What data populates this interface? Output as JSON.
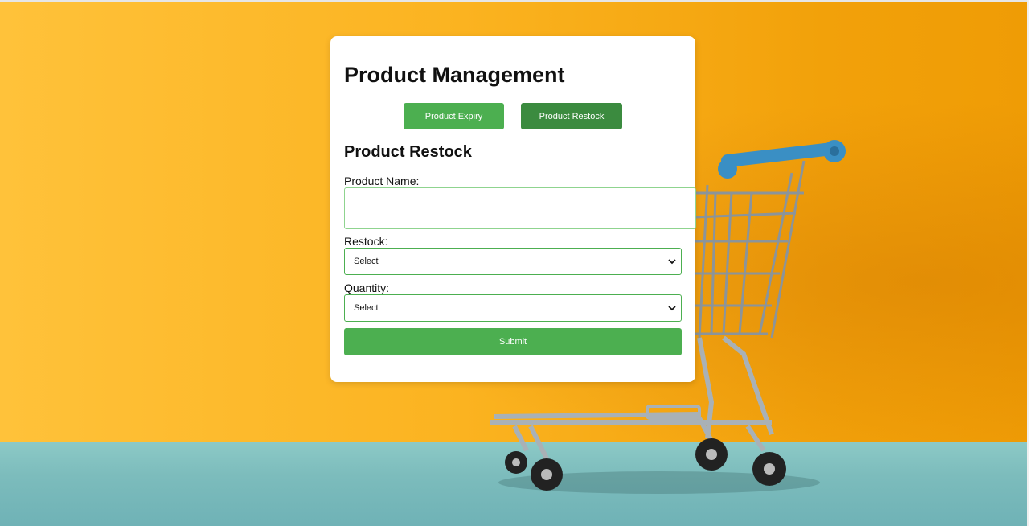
{
  "page": {
    "title": "Product Management",
    "tabs": [
      {
        "label": "Product Expiry",
        "color": "#4caf50"
      },
      {
        "label": "Product Restock",
        "color": "#3b8b3f",
        "active": true
      }
    ]
  },
  "form": {
    "heading": "Product Restock",
    "product_name": {
      "label": "Product Name:",
      "value": ""
    },
    "restock": {
      "label": "Restock:",
      "selected": "Select"
    },
    "quantity": {
      "label": "Quantity:",
      "selected": "Select"
    },
    "submit_label": "Submit"
  },
  "background": {
    "wall_color": "#fbb320",
    "floor_color": "#7cbcbc",
    "image": "shopping-cart-icon"
  }
}
